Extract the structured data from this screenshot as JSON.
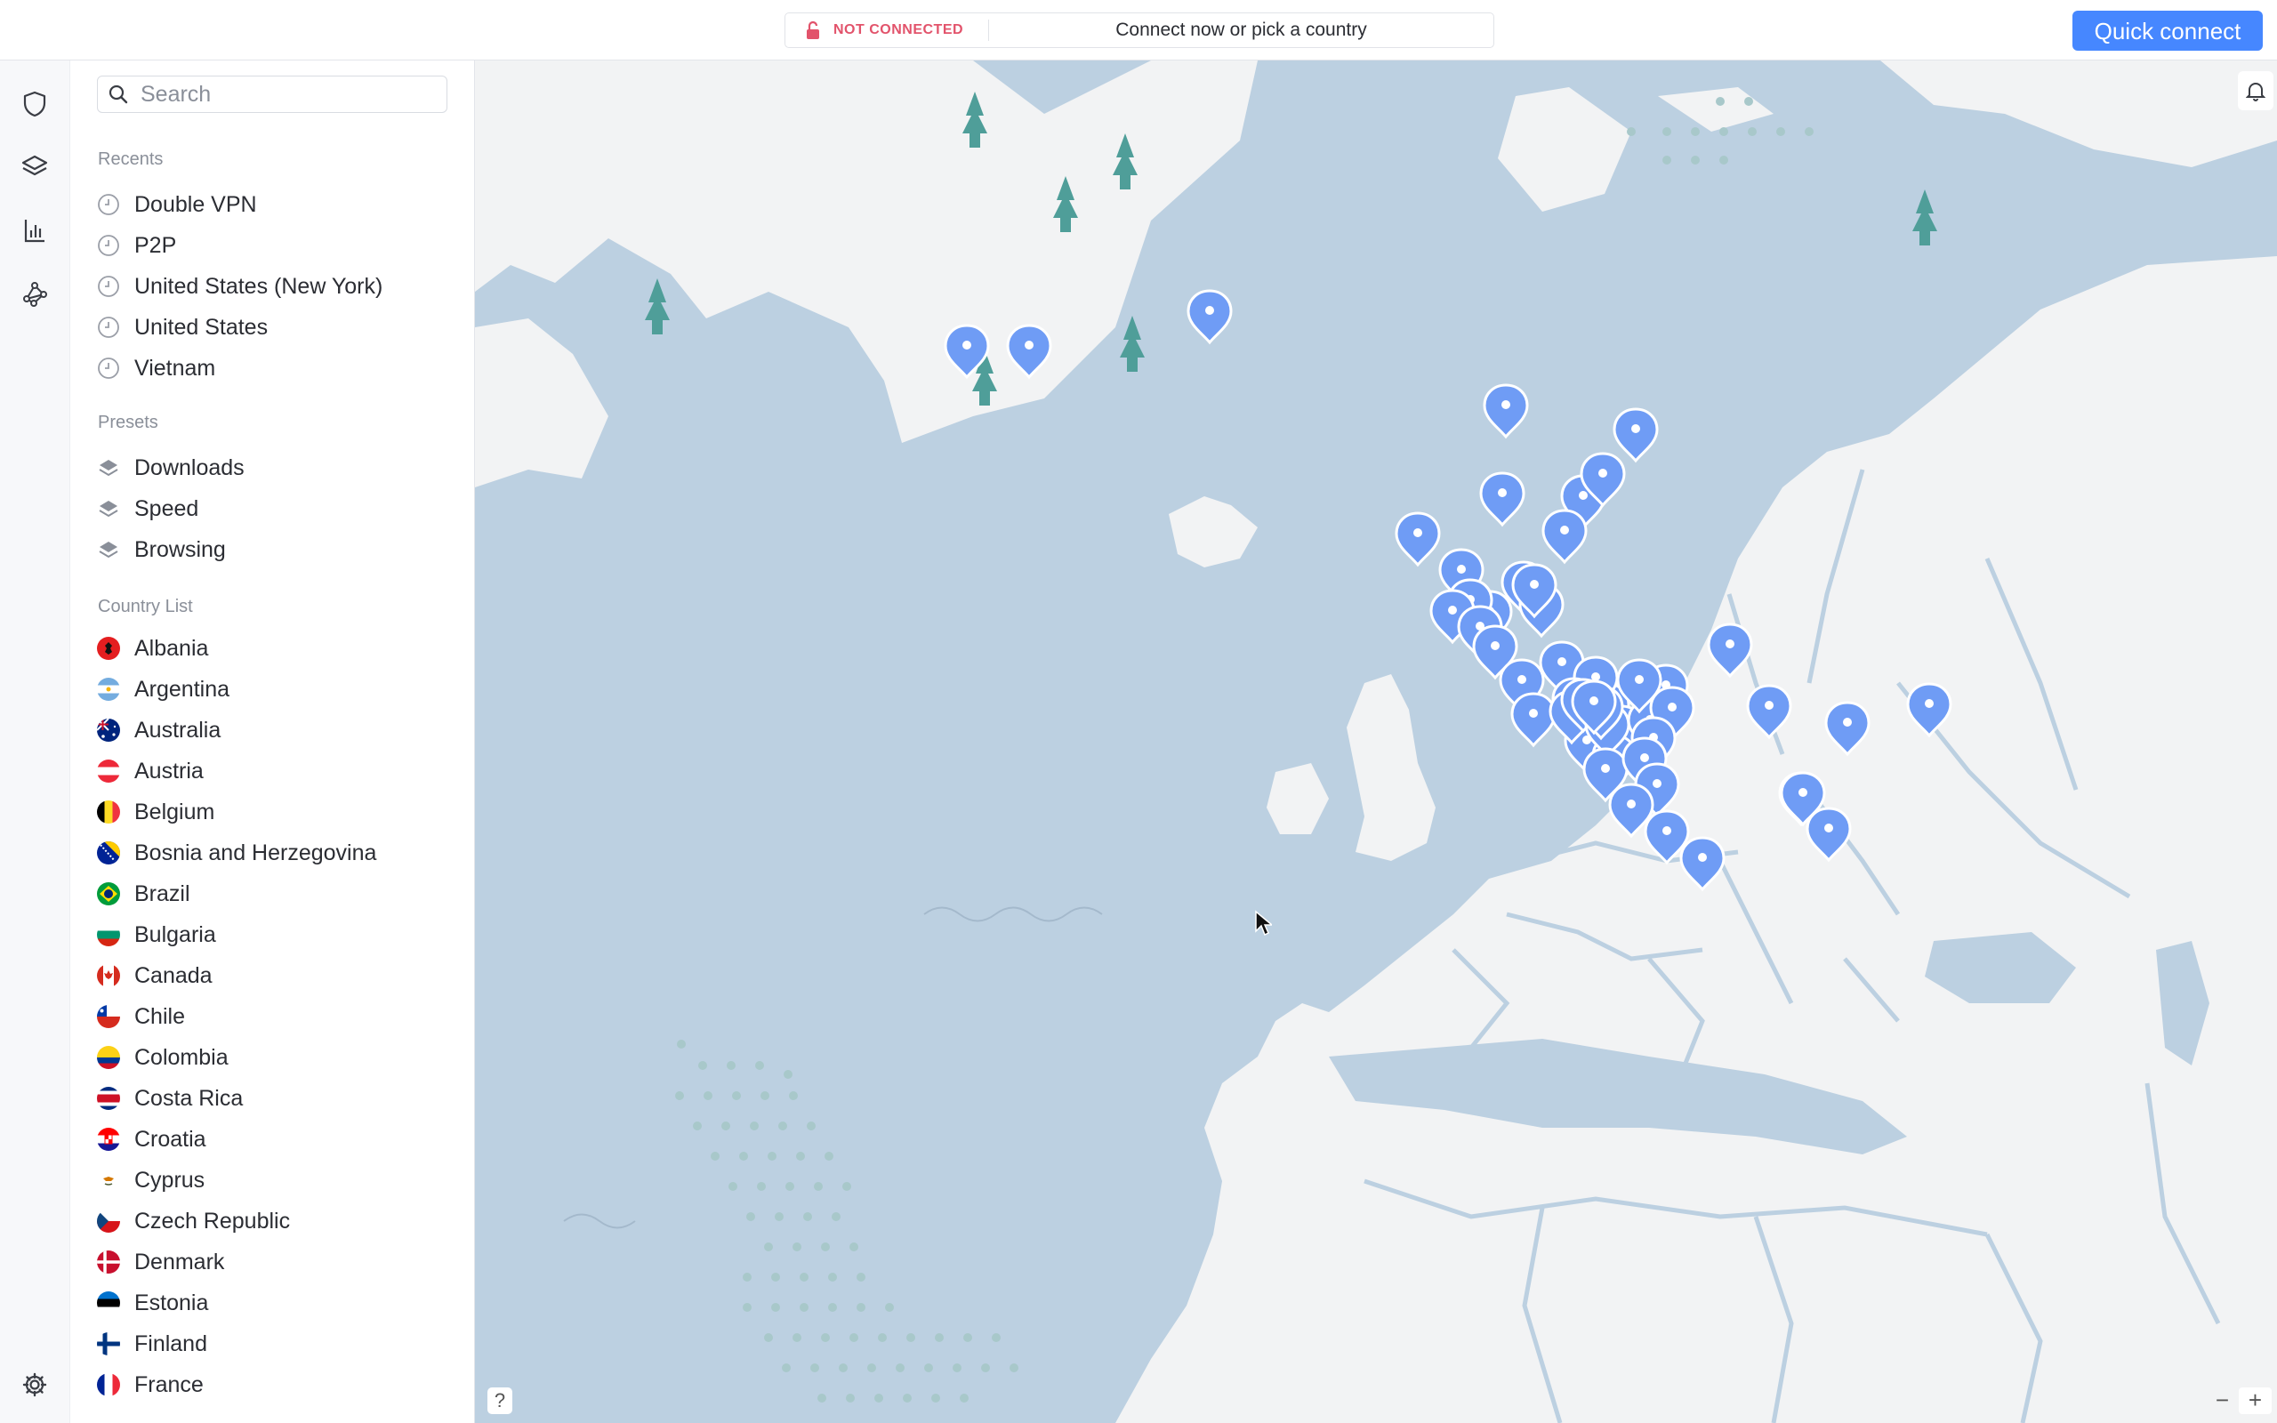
{
  "topbar": {
    "status": "NOT CONNECTED",
    "prompt": "Connect now or pick a country",
    "quick_connect": "Quick connect"
  },
  "rail": {
    "icons": [
      "shield-icon",
      "layers-icon",
      "chart-icon",
      "meshnet-icon",
      "gear-icon"
    ]
  },
  "sidebar": {
    "search_placeholder": "Search",
    "recents_title": "Recents",
    "recents": [
      "Double VPN",
      "P2P",
      "United States (New York)",
      "United States",
      "Vietnam"
    ],
    "presets_title": "Presets",
    "presets": [
      "Downloads",
      "Speed",
      "Browsing"
    ],
    "countries_title": "Country List",
    "countries": [
      "Albania",
      "Argentina",
      "Australia",
      "Austria",
      "Belgium",
      "Bosnia and Herzegovina",
      "Brazil",
      "Bulgaria",
      "Canada",
      "Chile",
      "Colombia",
      "Costa Rica",
      "Croatia",
      "Cyprus",
      "Czech Republic",
      "Denmark",
      "Estonia",
      "Finland",
      "France"
    ]
  },
  "map": {
    "help_label": "?",
    "zoom_out": "−",
    "zoom_in": "+"
  },
  "colors": {
    "accent": "#4687ff",
    "status": "#e2536b",
    "sea": "#bcd0e1",
    "land": "#f2f3f4",
    "pin": "#6f9cf5"
  }
}
